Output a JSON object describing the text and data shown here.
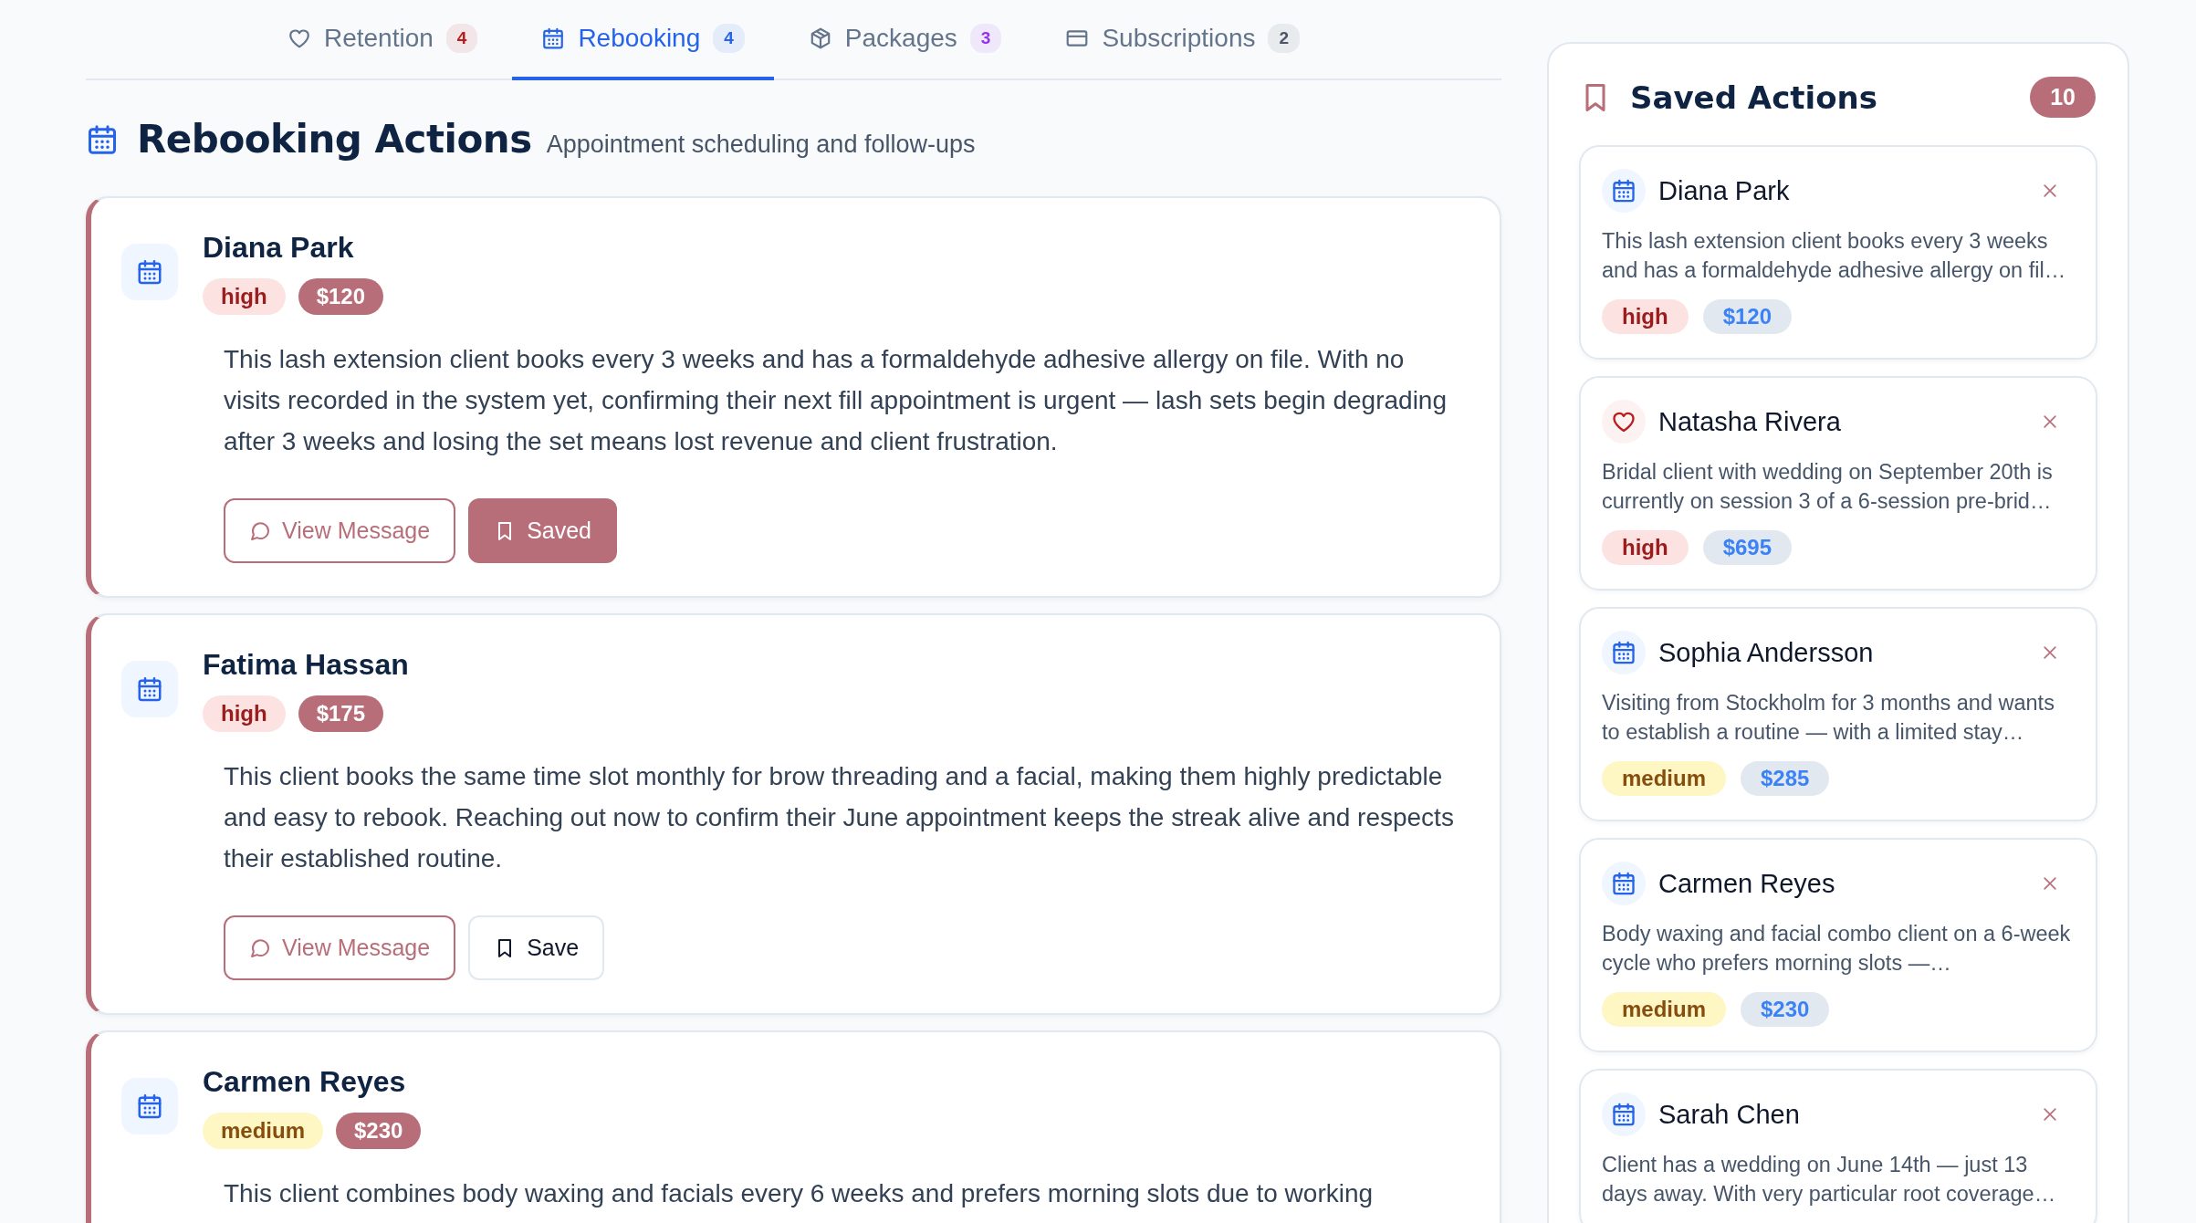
{
  "tabs": [
    {
      "label": "Retention",
      "kind": "retention",
      "count": "4",
      "color": "#b91c1c",
      "selected": false
    },
    {
      "label": "Rebooking",
      "kind": "rebooking",
      "count": "4",
      "color": "#2563eb",
      "selected": true
    },
    {
      "label": "Packages",
      "kind": "packages",
      "count": "3",
      "color": "#9333ea",
      "selected": false
    },
    {
      "label": "Subscriptions",
      "kind": "subscriptions",
      "count": "2",
      "color": "#4b5563",
      "selected": false
    }
  ],
  "section": {
    "kind": "rebooking",
    "title": "Rebooking Actions",
    "subtitle": "Appointment scheduling and follow-ups"
  },
  "actions": [
    {
      "kind": "rebooking",
      "name": "Diana Park",
      "priority": {
        "text": "high",
        "kind": "high"
      },
      "value": "$120",
      "description": "This lash extension client books every 3 weeks and has a formaldehyde adhesive allergy on file. With no visits recorded in the system yet, confirming their next fill appointment is urgent — lash sets begin degrading after 3 weeks and losing the set means lost revenue and client frustration.",
      "buttons": {
        "message": "View Message",
        "save": "Saved"
      },
      "saved": true
    },
    {
      "kind": "rebooking",
      "name": "Fatima Hassan",
      "priority": {
        "text": "high",
        "kind": "high"
      },
      "value": "$175",
      "description": "This client books the same time slot monthly for brow threading and a facial, making them highly predictable and easy to rebook. Reaching out now to confirm their June appointment keeps the streak alive and respects their established routine.",
      "buttons": {
        "message": "View Message",
        "save": "Save"
      },
      "saved": false
    },
    {
      "kind": "rebooking",
      "name": "Carmen Reyes",
      "priority": {
        "text": "medium",
        "kind": "medium"
      },
      "value": "$230",
      "description": "This client combines body waxing and facials every 6 weeks and prefers morning slots due to working"
    }
  ],
  "saved_panel": {
    "title": "Saved Actions",
    "count": "10",
    "items": [
      {
        "kind": "rebooking",
        "name": "Diana Park",
        "description": "This lash extension client books every 3 weeks and has a formaldehyde adhesive allergy on fil…",
        "priority": {
          "text": "high",
          "kind": "high"
        },
        "value": "$120"
      },
      {
        "kind": "retention",
        "name": "Natasha Rivera",
        "description": "Bridal client with wedding on September 20th is currently on session 3 of a 6-session pre-brid…",
        "priority": {
          "text": "high",
          "kind": "high"
        },
        "value": "$695"
      },
      {
        "kind": "rebooking",
        "name": "Sophia Andersson",
        "description": "Visiting from Stockholm for 3 months and wants to establish a routine — with a limited stay…",
        "priority": {
          "text": "medium",
          "kind": "medium"
        },
        "value": "$285"
      },
      {
        "kind": "rebooking",
        "name": "Carmen Reyes",
        "description": "Body waxing and facial combo client on a 6-week cycle who prefers morning slots —…",
        "priority": {
          "text": "medium",
          "kind": "medium"
        },
        "value": "$230"
      },
      {
        "kind": "rebooking",
        "name": "Sarah Chen",
        "description": "Client has a wedding on June 14th — just 13 days away. With very particular root coverage…"
      }
    ]
  }
}
